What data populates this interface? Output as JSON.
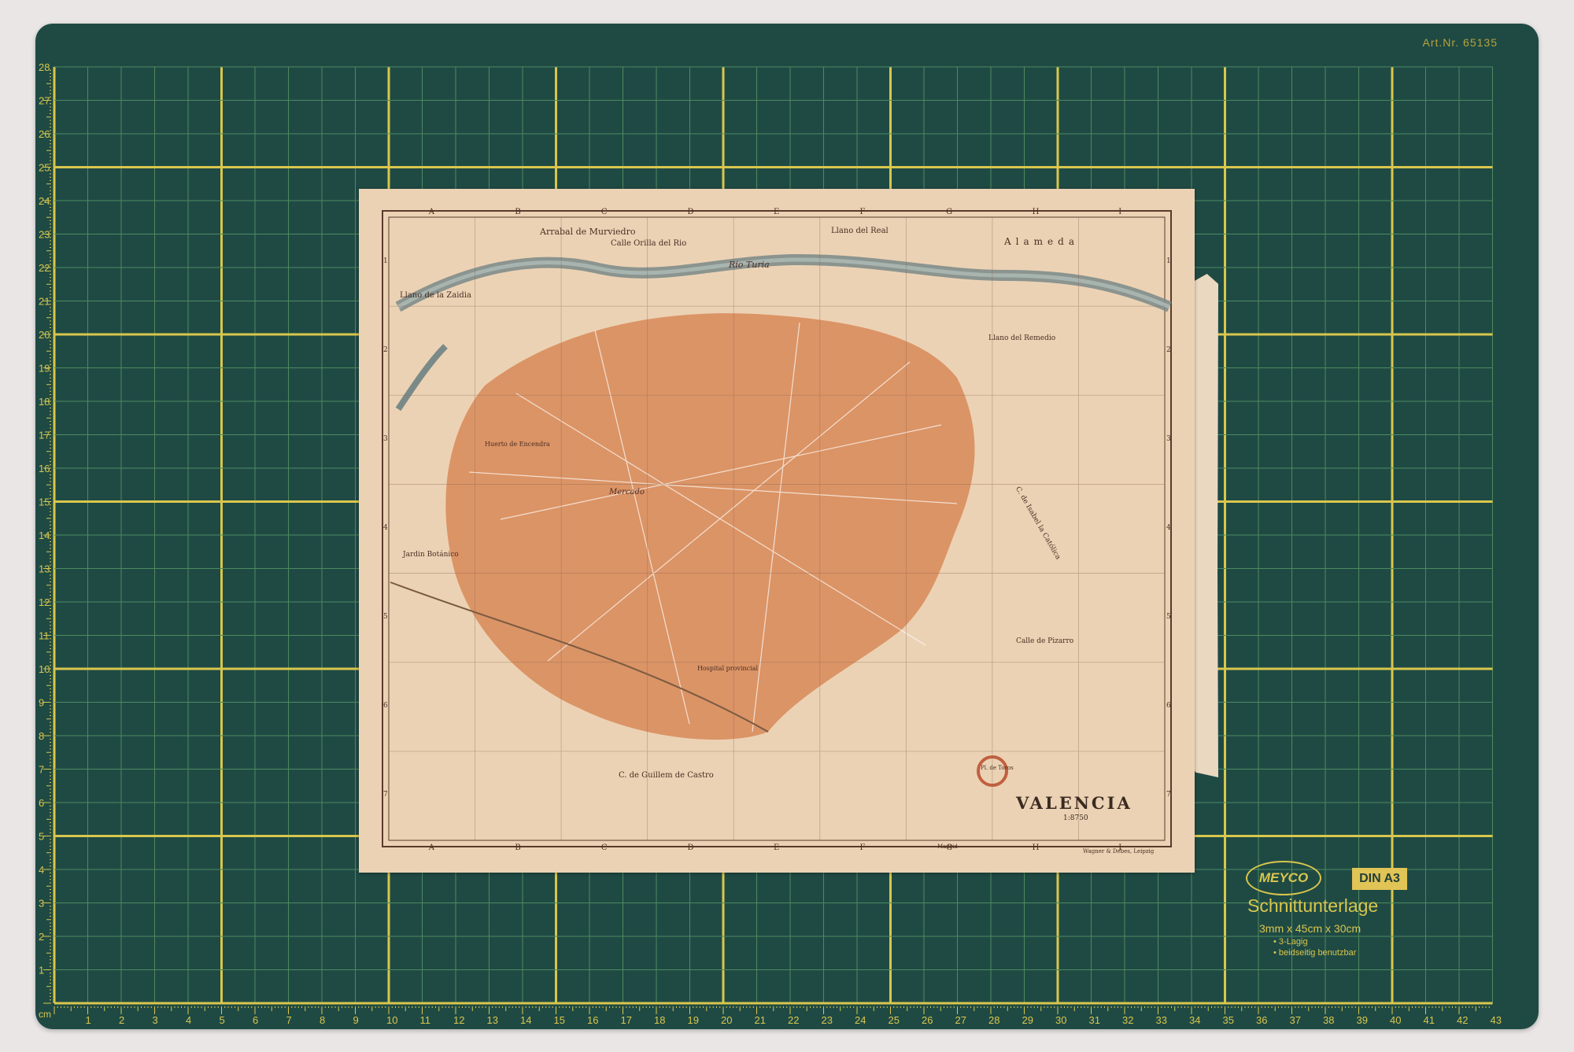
{
  "mat": {
    "art_nr": "Art.Nr. 65135",
    "unit": "cm",
    "top_scale_numbers": [
      "1",
      "2",
      "3",
      "4",
      "5",
      "6",
      "7",
      "8",
      "9",
      "10",
      "11",
      "12",
      "13",
      "14",
      "15",
      "16",
      "17",
      "18",
      "19",
      "20",
      "21",
      "22",
      "23",
      "24",
      "25",
      "26",
      "27",
      "28",
      "29",
      "30",
      "31",
      "32",
      "33",
      "34",
      "35",
      "36",
      "37",
      "38",
      "39",
      "40",
      "41",
      "42",
      "43"
    ],
    "side_scale_numbers": [
      "1",
      "2",
      "3",
      "4",
      "5",
      "6",
      "7",
      "8",
      "9",
      "10",
      "11",
      "12",
      "13",
      "14",
      "15",
      "16",
      "17",
      "18",
      "19",
      "20",
      "21",
      "22",
      "23",
      "24",
      "25",
      "26",
      "27",
      "28"
    ],
    "brand": "MEYCO",
    "size_badge": "DIN A3",
    "product_name": "Schnittunterlage",
    "dimensions": "3mm x 45cm x 30cm",
    "features": [
      "• 3-Lagig",
      "• beidseitig benutzbar"
    ],
    "colors": {
      "mat": "#1f4a44",
      "grid": "#d9c64d",
      "fine_grid": "#4e8a5f"
    }
  },
  "map": {
    "title": "VALENCIA",
    "scale": "1:8750",
    "column_letters": [
      "A",
      "B",
      "C",
      "D",
      "E",
      "F",
      "G",
      "H",
      "I"
    ],
    "row_numbers": [
      "1",
      "2",
      "3",
      "4",
      "5",
      "6",
      "7"
    ],
    "labels": {
      "arrabal": "Arrabal de Murviedro",
      "calle_orilla": "Calle Orilla del Rio",
      "rio_turia": "Rio Turia",
      "llano_real": "Llano del Real",
      "alameda": "Alameda",
      "llano_zaidia": "Llano de la Zaidia",
      "llano_remedio": "Llano del Remedio",
      "jardin": "Jardin Botánico",
      "huerto": "Huerto de Encendra",
      "mercado": "Mercado",
      "hospital": "Hospital provincial",
      "guillem": "C. de Guillem de Castro",
      "isabel": "C. de Isabel la Católica",
      "pizarro": "Calle de Pizarro",
      "toros": "Pl. de Toros",
      "publisher": "Wagner & Debes, Leipzig",
      "madrid": "Madrid"
    },
    "colors": {
      "paper": "#ecd2b4",
      "city": "#d98d5d",
      "river": "#7a8a88"
    }
  }
}
